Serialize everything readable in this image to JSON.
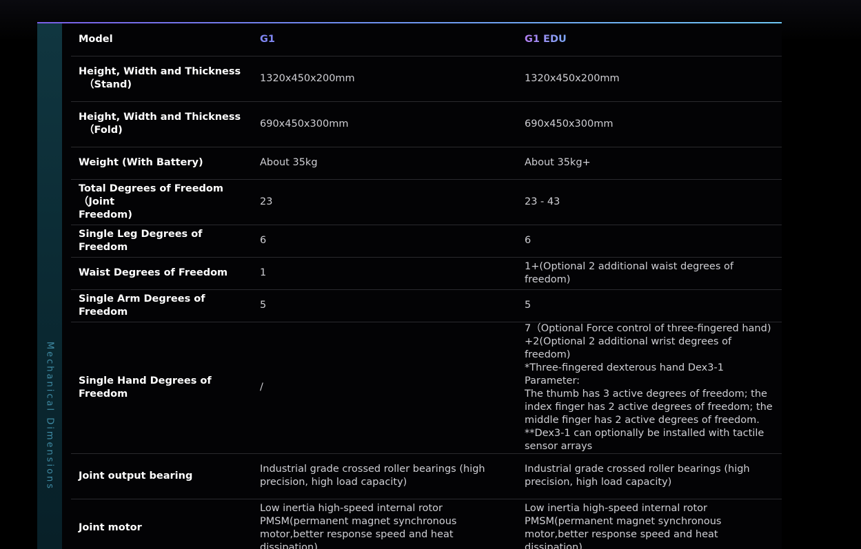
{
  "section": {
    "title": "Mechanical Dimensions"
  },
  "table": {
    "header": {
      "label": "Model",
      "g1": "G1",
      "edu": "G1 EDU"
    },
    "rows": [
      {
        "label_lines": [
          "Height, Width and Thickness",
          "（Stand)"
        ],
        "g1_lines": [
          "1320x450x200mm"
        ],
        "edu_lines": [
          "1320x450x200mm"
        ]
      },
      {
        "label_lines": [
          "Height, Width and Thickness",
          "（Fold)"
        ],
        "g1_lines": [
          "690x450x300mm"
        ],
        "edu_lines": [
          "690x450x300mm"
        ]
      },
      {
        "label_lines": [
          "Weight (With Battery)"
        ],
        "g1_lines": [
          "About 35kg"
        ],
        "edu_lines": [
          "About 35kg+"
        ]
      },
      {
        "label_lines": [
          "Total Degrees of Freedom（Joint",
          "Freedom)"
        ],
        "g1_lines": [
          "23"
        ],
        "edu_lines": [
          "23 - 43"
        ]
      },
      {
        "label_lines": [
          "Single Leg Degrees of Freedom"
        ],
        "g1_lines": [
          "6"
        ],
        "edu_lines": [
          "6"
        ]
      },
      {
        "label_lines": [
          "Waist Degrees of Freedom"
        ],
        "g1_lines": [
          "1"
        ],
        "edu_lines": [
          "1+(Optional 2 additional waist degrees of freedom)"
        ]
      },
      {
        "label_lines": [
          "Single Arm Degrees of Freedom"
        ],
        "g1_lines": [
          "5"
        ],
        "edu_lines": [
          "5"
        ]
      },
      {
        "label_lines": [
          "Single Hand Degrees of Freedom"
        ],
        "g1_lines": [
          "/"
        ],
        "edu_lines": [
          "7（Optional Force control of three-fingered hand)",
          "+2(Optional 2 additional wrist degrees of freedom)",
          "*Three-fingered dexterous hand Dex3-1 Parameter:",
          "The thumb has 3 active degrees of freedom; the",
          "index finger has 2 active degrees of freedom; the",
          "middle finger has 2 active degrees of freedom.",
          "**Dex3-1 can optionally be installed with tactile",
          "sensor arrays"
        ]
      },
      {
        "label_lines": [
          "Joint output bearing"
        ],
        "g1_lines": [
          "Industrial grade crossed roller bearings (high",
          "precision, high load capacity)"
        ],
        "edu_lines": [
          "Industrial grade crossed roller bearings (high",
          "precision, high load capacity)"
        ]
      },
      {
        "label_lines": [
          "Joint motor"
        ],
        "g1_lines": [
          "Low inertia high-speed internal rotor",
          "PMSM(permanent magnet synchronous",
          "motor,better response speed and heat dissipation)"
        ],
        "edu_lines": [
          "Low inertia high-speed internal rotor",
          "PMSM(permanent magnet synchronous",
          "motor,better response speed and heat dissipation)"
        ]
      }
    ]
  },
  "colors": {
    "accent_g1": "#7f86f2",
    "accent_edu_start": "#b17df0",
    "accent_edu_end": "#7ba6f5",
    "side_bar": "#0b2a33",
    "divider": "#2a2a2e"
  }
}
